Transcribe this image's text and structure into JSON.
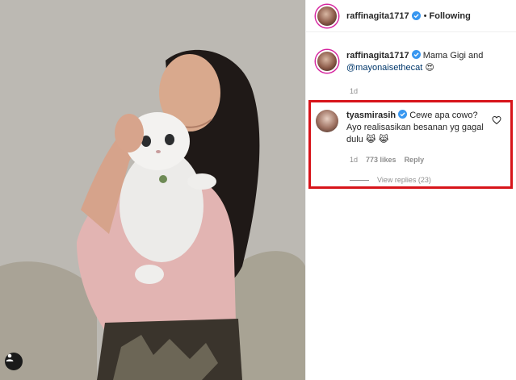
{
  "post": {
    "author": "raffinagita1717",
    "follow_status": "Following",
    "separator": "•",
    "caption_text": "Mama Gigi and",
    "caption_mention": "@mayonaisethecat",
    "caption_emoji": "😍",
    "caption_age": "1d"
  },
  "comment": {
    "author": "tyasmirasih",
    "text": "Cewe apa cowo? Ayo realisasikan besanan yg gagal dulu",
    "emoji": "😹 😹",
    "age": "1d",
    "likes": "773 likes",
    "reply_label": "Reply",
    "view_replies": "View replies (23)"
  },
  "colors": {
    "highlight_border": "#d7141a",
    "verified_blue": "#3897f0",
    "mention_blue": "#00376b"
  },
  "icons": [
    "verified-badge-icon",
    "heart-icon",
    "tag-user-icon"
  ]
}
